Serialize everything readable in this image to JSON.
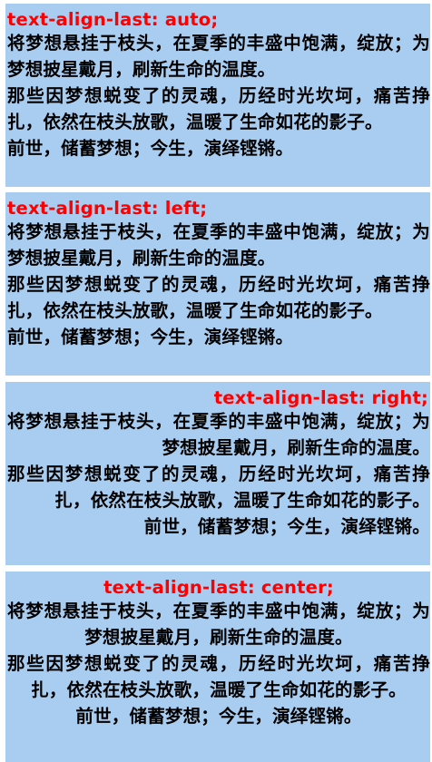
{
  "sections": [
    {
      "label": "text-align-last: auto;",
      "paragraphs": [
        "将梦想悬挂于枝头，在夏季的丰盛中饱满，绽放；为梦想披星戴月，刷新生命的温度。",
        "那些因梦想蜕变了的灵魂，历经时光坎坷，痛苦挣扎，依然在枝头放歌，温暖了生命如花的影子。",
        "前世，储蓄梦想；今生，演绎铿锵。"
      ]
    },
    {
      "label": "text-align-last: left;",
      "paragraphs": [
        "将梦想悬挂于枝头，在夏季的丰盛中饱满，绽放；为梦想披星戴月，刷新生命的温度。",
        "那些因梦想蜕变了的灵魂，历经时光坎坷，痛苦挣扎，依然在枝头放歌，温暖了生命如花的影子。",
        "前世，储蓄梦想；今生，演绎铿锵。"
      ]
    },
    {
      "label": "text-align-last: right;",
      "paragraphs": [
        "将梦想悬挂于枝头，在夏季的丰盛中饱满，绽放；为梦想披星戴月，刷新生命的温度。",
        "那些因梦想蜕变了的灵魂，历经时光坎坷，痛苦挣扎，依然在枝头放歌，温暖了生命如花的影子。",
        "前世，储蓄梦想；今生，演绎铿锵。"
      ]
    },
    {
      "label": "text-align-last: center;",
      "paragraphs": [
        "将梦想悬挂于枝头，在夏季的丰盛中饱满，绽放；为梦想披星戴月，刷新生命的温度。",
        "那些因梦想蜕变了的灵魂，历经时光坎坷，痛苦挣扎，依然在枝头放歌，温暖了生命如花的影子。",
        "前世，储蓄梦想；今生，演绎铿锵。"
      ]
    }
  ],
  "colors": {
    "panel_background": "#a9cdf0",
    "label_text": "#ff0000",
    "body_text": "#000000"
  }
}
